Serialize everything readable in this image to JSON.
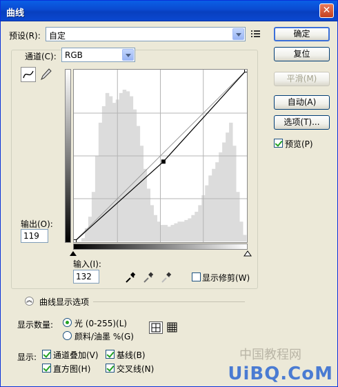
{
  "window": {
    "title": "曲线",
    "close_glyph": "✕"
  },
  "preset": {
    "label": "预设(R):",
    "value": "自定",
    "menu_icon": "list-menu-icon"
  },
  "channel": {
    "label": "通道(C):",
    "value": "RGB"
  },
  "output": {
    "label": "输出(O):",
    "value": "119"
  },
  "input": {
    "label": "输入(I):",
    "value": "132"
  },
  "buttons": {
    "ok": "确定",
    "reset": "复位",
    "smooth": "平滑(M)",
    "auto": "自动(A)",
    "options": "选项(T)..."
  },
  "preview": {
    "label": "预览(P)",
    "checked": true
  },
  "show_clipping": {
    "label": "显示修剪(W)",
    "checked": false
  },
  "curve_display": {
    "label": "曲线显示选项",
    "expander_glyph": "︽"
  },
  "show_amount": {
    "label": "显示数量:",
    "options": [
      {
        "label": "光 (0-255)(L)",
        "selected": true
      },
      {
        "label": "颜料/油墨 %(G)",
        "selected": false
      }
    ]
  },
  "show": {
    "label": "显示:",
    "options": [
      {
        "label": "通道叠加(V)",
        "checked": true
      },
      {
        "label": "基线(B)",
        "checked": true
      },
      {
        "label": "直方图(H)",
        "checked": true
      },
      {
        "label": "交叉线(N)",
        "checked": true
      }
    ]
  },
  "watermark": {
    "text": "UiBQ.CoM",
    "faint": "中国教程网"
  },
  "chart_data": {
    "type": "line",
    "x_range": [
      0,
      255
    ],
    "y_range": [
      0,
      255
    ],
    "curve_points": [
      [
        0,
        0
      ],
      [
        132,
        119
      ],
      [
        255,
        255
      ]
    ],
    "baseline": [
      [
        0,
        0
      ],
      [
        255,
        255
      ]
    ],
    "histogram": [
      0,
      0,
      2,
      8,
      15,
      30,
      52,
      72,
      82,
      90,
      88,
      84,
      86,
      90,
      92,
      91,
      88,
      80,
      70,
      58,
      44,
      32,
      22,
      16,
      12,
      10,
      10,
      9,
      10,
      11,
      12,
      12,
      13,
      14,
      16,
      18,
      22,
      28,
      34,
      40,
      44,
      48,
      54,
      60,
      66,
      72,
      58,
      30,
      12,
      4
    ]
  }
}
